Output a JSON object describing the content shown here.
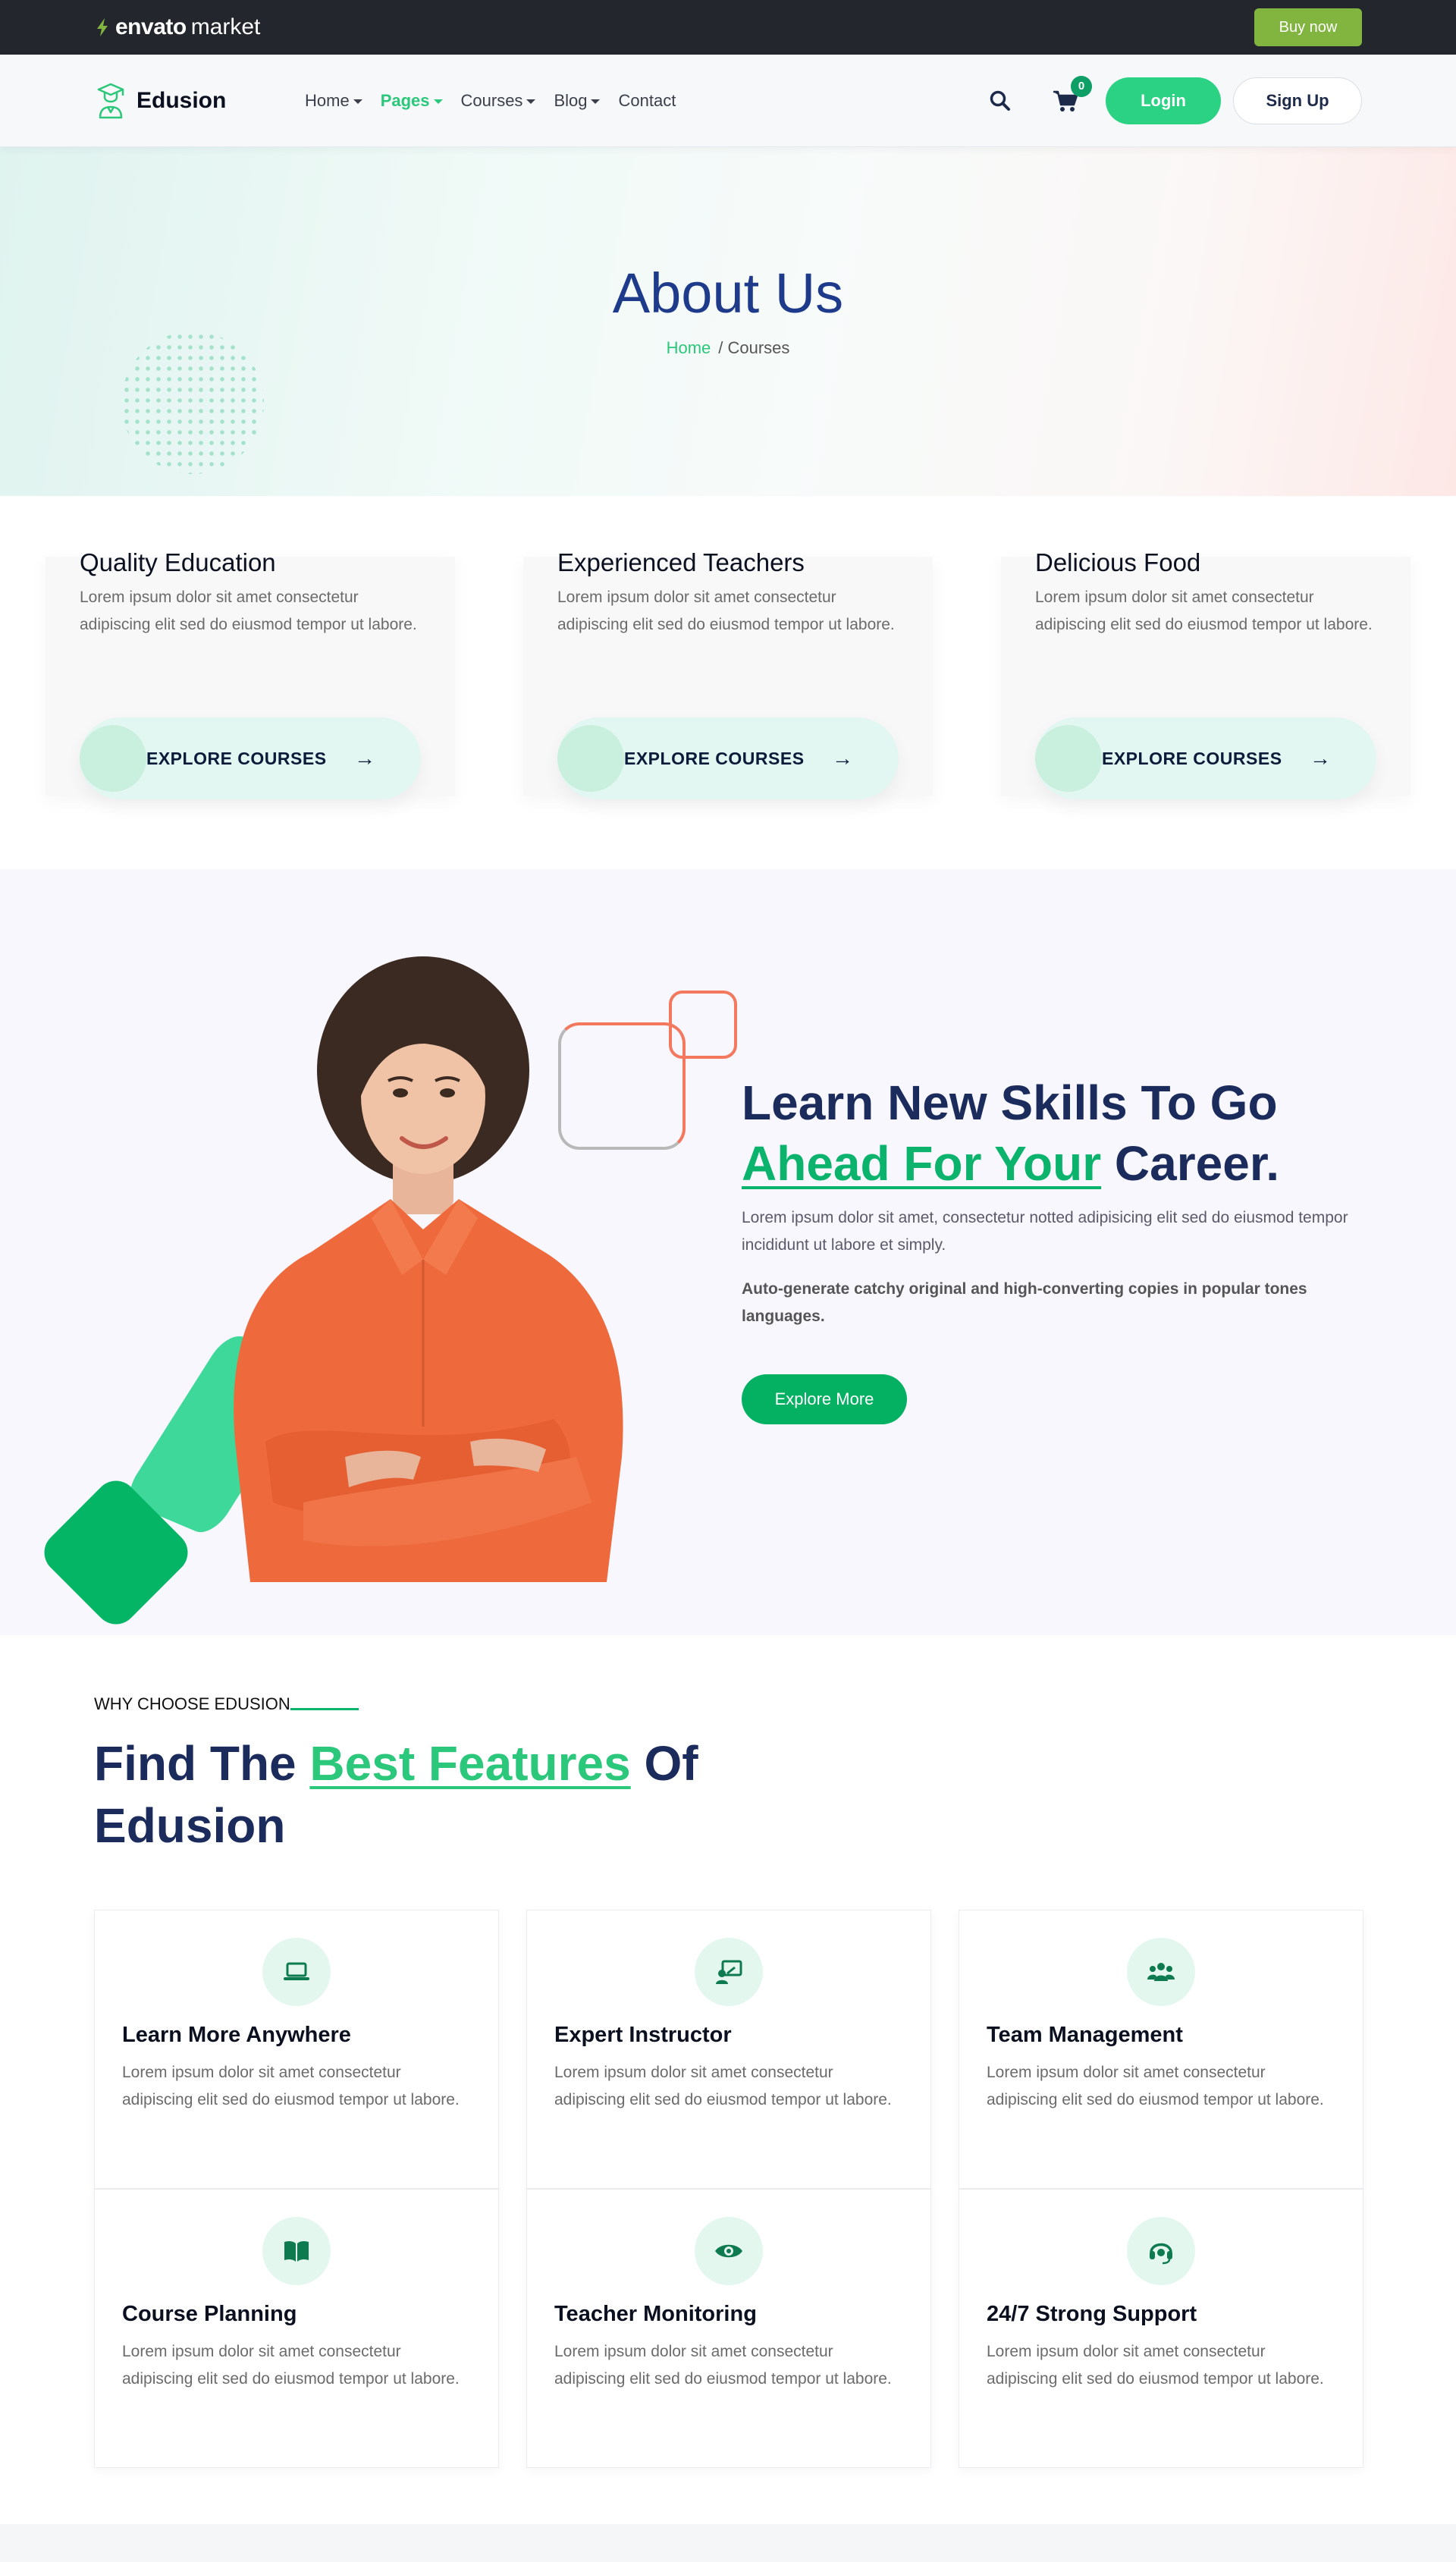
{
  "envato": {
    "brand": "envato",
    "market": "market",
    "buy_label": "Buy now"
  },
  "nav": {
    "logo_text": "Edusion",
    "menu": [
      {
        "label": "Home",
        "dropdown": true,
        "active": false
      },
      {
        "label": "Pages",
        "dropdown": true,
        "active": true
      },
      {
        "label": "Courses",
        "dropdown": true,
        "active": false
      },
      {
        "label": "Blog",
        "dropdown": true,
        "active": false
      },
      {
        "label": "Contact",
        "dropdown": false,
        "active": false
      }
    ],
    "cart_count": "0",
    "login_label": "Login",
    "signup_label": "Sign Up"
  },
  "hero": {
    "title": "About Us",
    "breadcrumb_home": "Home",
    "breadcrumb_current": "/ Courses"
  },
  "info_cards": [
    {
      "title": "Quality Education",
      "text": "Lorem ipsum dolor sit amet consectetur adipiscing elit sed do eiusmod tempor ut labore.",
      "button": "EXPLORE COURSES",
      "arrow": "→"
    },
    {
      "title": "Experienced Teachers",
      "text": "Lorem ipsum dolor sit amet consectetur adipiscing elit sed do eiusmod tempor ut labore.",
      "button": "EXPLORE COURSES",
      "arrow": "→"
    },
    {
      "title": "Delicious Food",
      "text": "Lorem ipsum dolor sit amet consectetur adipiscing elit sed do eiusmod tempor ut labore.",
      "button": "EXPLORE COURSES",
      "arrow": "→"
    }
  ],
  "learn": {
    "title_line1": "Learn New Skills To Go",
    "title_highlight": "Ahead For Your",
    "title_end": " Career.",
    "description": "Lorem ipsum dolor sit amet, consectetur notted adipisicing elit sed do eiusmod tempor incididunt ut labore et simply.",
    "strong": "Auto-generate catchy original and high-converting copies in popular tones languages.",
    "button": "Explore More"
  },
  "features": {
    "eyebrow": "WHY CHOOSE EDUSION",
    "title_start": "Find The ",
    "title_highlight": "Best Features",
    "title_end": " Of Edusion",
    "items": [
      {
        "icon": "laptop-icon",
        "title": "Learn More Anywhere",
        "text": "Lorem ipsum dolor sit amet consectetur adipiscing elit sed do eiusmod tempor ut labore."
      },
      {
        "icon": "instructor-icon",
        "title": "Expert Instructor",
        "text": "Lorem ipsum dolor sit amet consectetur adipiscing elit sed do eiusmod tempor ut labore."
      },
      {
        "icon": "team-icon",
        "title": "Team Management",
        "text": "Lorem ipsum dolor sit amet consectetur adipiscing elit sed do eiusmod tempor ut labore."
      },
      {
        "icon": "book-icon",
        "title": "Course Planning",
        "text": "Lorem ipsum dolor sit amet consectetur adipiscing elit sed do eiusmod tempor ut labore."
      },
      {
        "icon": "eye-icon",
        "title": "Teacher Monitoring",
        "text": "Lorem ipsum dolor sit amet consectetur adipiscing elit sed do eiusmod tempor ut labore."
      },
      {
        "icon": "headset-icon",
        "title": "24/7 Strong Support",
        "text": "Lorem ipsum dolor sit amet consectetur adipiscing elit sed do eiusmod tempor ut labore."
      }
    ]
  },
  "colors": {
    "accent": "#2bc77a",
    "accent_dark": "#04b163",
    "navy": "#1a2b5c",
    "envato_green": "#82b440",
    "coral": "#f3785e"
  }
}
